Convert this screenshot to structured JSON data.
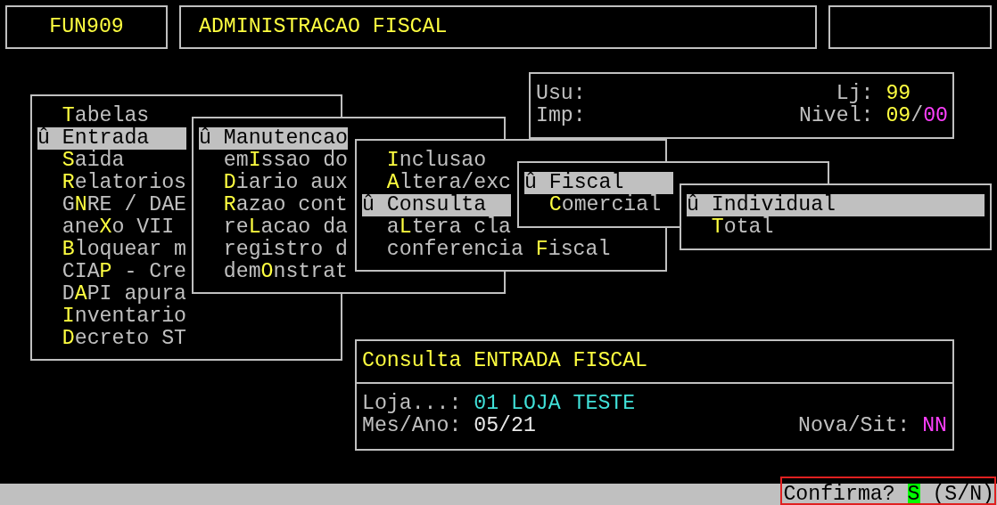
{
  "header": {
    "program_code": "FUN909",
    "title": "ADMINISTRACAO FISCAL"
  },
  "session_info": {
    "user_label": "Usu:",
    "printer_label": "Imp:",
    "store_label": "Lj:",
    "store_value": "99",
    "level_label": "Nivel:",
    "level_value": "09",
    "level_separator": "/",
    "level_sublevel": "00"
  },
  "menus": [
    {
      "items": [
        {
          "label": "**T**abelas",
          "selected": false
        },
        {
          "label": "û Entrada",
          "selected": true
        },
        {
          "label": "**S**aida",
          "selected": false
        },
        {
          "label": "**R**elatorios",
          "selected": false
        },
        {
          "label": "G**N**RE / DAE",
          "selected": false
        },
        {
          "label": "ane**X**o VII",
          "selected": false
        },
        {
          "label": "**B**loquear m",
          "selected": false
        },
        {
          "label": "CIA**P** - Cre",
          "selected": false
        },
        {
          "label": "D**A**PI apura",
          "selected": false
        },
        {
          "label": "**I**nventario",
          "selected": false
        },
        {
          "label": "**D**ecreto ST",
          "selected": false
        }
      ]
    },
    {
      "items": [
        {
          "label": "û Manutencao",
          "selected": true
        },
        {
          "label": "em**I**ssao do",
          "selected": false
        },
        {
          "label": "**D**iario aux",
          "selected": false
        },
        {
          "label": "**R**azao cont",
          "selected": false
        },
        {
          "label": "re**L**acao da",
          "selected": false
        },
        {
          "label": "registro d",
          "selected": false
        },
        {
          "label": "dem**O**nstrat",
          "selected": false
        }
      ]
    },
    {
      "items": [
        {
          "label": "**I**nclusao",
          "selected": false
        },
        {
          "label": "**A**ltera/exc",
          "selected": false
        },
        {
          "label": "û Consulta",
          "selected": true
        },
        {
          "label": "a**L**tera cla",
          "selected": false
        },
        {
          "label": "conferencia **F**iscal",
          "selected": false
        }
      ]
    },
    {
      "items": [
        {
          "label": "û Fiscal",
          "selected": true
        },
        {
          "label": "**C**omercial",
          "selected": false
        }
      ]
    },
    {
      "items": [
        {
          "label": "û Individual",
          "selected": true
        },
        {
          "label": "**T**otal",
          "selected": false
        }
      ]
    }
  ],
  "query_panel": {
    "title": "Consulta ENTRADA FISCAL",
    "store_label": "Loja...:",
    "store_value": "01 LOJA TESTE",
    "period_label": "Mes/Ano:",
    "period_value": "05/21",
    "status_label": "Nova/Sit:",
    "status_value": "NN"
  },
  "status_bar": {
    "prompt": "Confirma?",
    "answer": "S",
    "options": "(S/N)",
    "highlighted": true
  }
}
